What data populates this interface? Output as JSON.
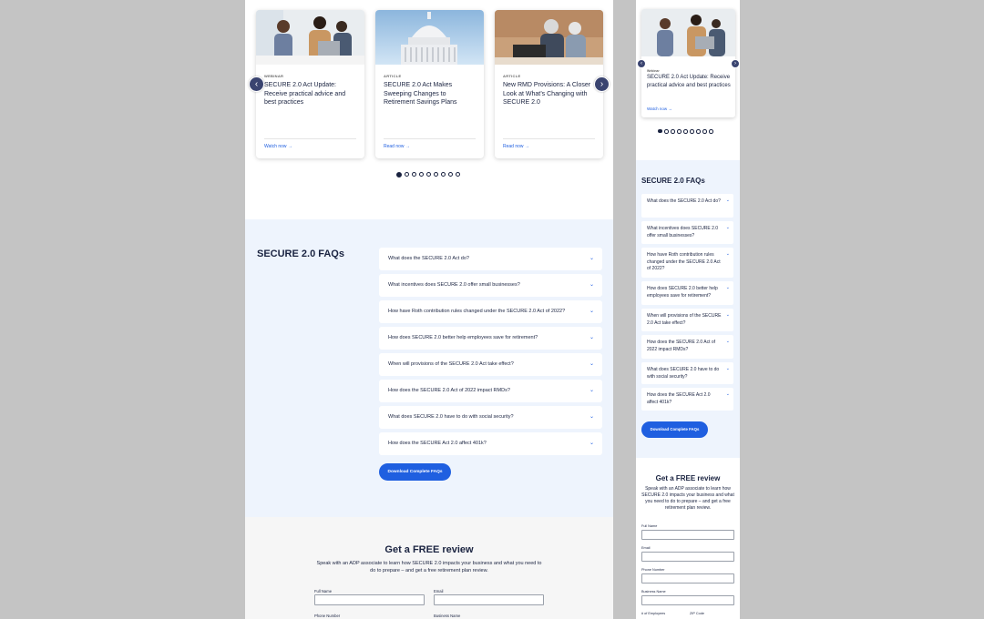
{
  "cards": [
    {
      "tag": "WEBINAR",
      "title": "SECURE 2.0 Act Update: Receive practical advice and best practices",
      "link": "Watch now →",
      "image": "people-meeting-laptop"
    },
    {
      "tag": "ARTICLE",
      "title": "SECURE 2.0 Act Makes Sweeping Changes to Retirement Savings Plans",
      "link": "Read now →",
      "image": "capitol-building"
    },
    {
      "tag": "ARTICLE",
      "title": "New RMD Provisions: A Closer Look at What’s Changing with SECURE 2.0",
      "link": "Read now →",
      "image": "senior-couple-laptop"
    }
  ],
  "mobile_card": {
    "tag": "Webinar",
    "title": "SECURE 2.0 Act Update: Receive practical advice and best practices",
    "link": "Watch now →"
  },
  "carousel": {
    "prev_icon": "‹",
    "next_icon": "›",
    "dot_count": 9,
    "active_index": 0
  },
  "faq": {
    "title": "SECURE 2.0 FAQs",
    "chevron": "⌄",
    "questions": [
      "What does the SECURE 2.0 Act do?",
      "What incentives does SECURE 2.0 offer small businesses?",
      "How have Roth contribution rules changed under the SECURE 2.0 Act of 2022?",
      "How does SECURE 2.0 better help employees save for retirement?",
      "When will provisions of the SECURE 2.0 Act take effect?",
      "How does the SECURE 2.0 Act of 2022 impact RMDs?",
      "What does SECURE 2.0 have to do with social security?",
      "How does the SECURE Act 2.0 affect 401k?"
    ],
    "download_label": "Download Complete FAQs"
  },
  "review": {
    "title": "Get a FREE review",
    "subtitle": "Speak with an ADP associate to learn how SECURE 2.0 impacts your business and what you need to do to prepare – and get a free retirement plan review.",
    "fields": {
      "full_name": "Full Name",
      "email": "Email",
      "phone": "Phone Number",
      "business": "Business Name",
      "employees": "# of Employees",
      "zip": "ZIP Code"
    }
  },
  "colors": {
    "accent": "#1f5fe0",
    "navy": "#1a2340",
    "faq_bg": "#eef4fd"
  }
}
